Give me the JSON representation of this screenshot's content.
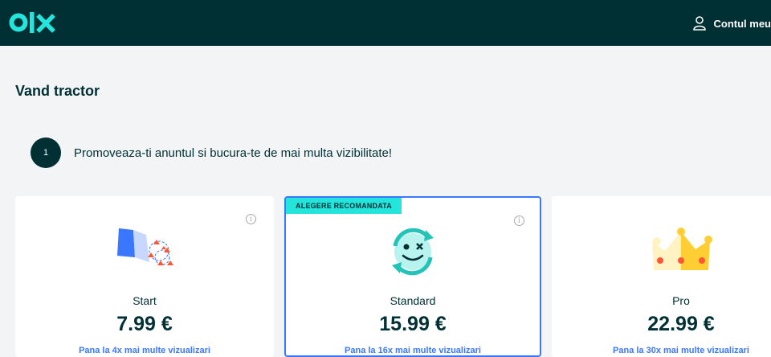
{
  "header": {
    "logo_text": "olx",
    "account_label": "Contul meu"
  },
  "page": {
    "title": "Vand tractor"
  },
  "step": {
    "number": "1",
    "text": "Promoveaza-ti anuntul si bucura-te de mai multa vizibilitate!"
  },
  "packages": [
    {
      "name": "Start",
      "price": "7.99 €",
      "link": "Pana la 4x mai multe vizualizari"
    },
    {
      "name": "Standard",
      "price": "15.99 €",
      "link": "Pana la 16x mai multe vizualizari",
      "badge": "ALEGERE RECOMANDATA"
    },
    {
      "name": "Pro",
      "price": "22.99 €",
      "link": "Pana la 30x mai multe vizualizari"
    }
  ],
  "colors": {
    "header_bg": "#002f34",
    "accent": "#23e5db",
    "selected_border": "#3a77ff"
  },
  "icons": {
    "account": "user-icon",
    "info": "info-icon"
  }
}
